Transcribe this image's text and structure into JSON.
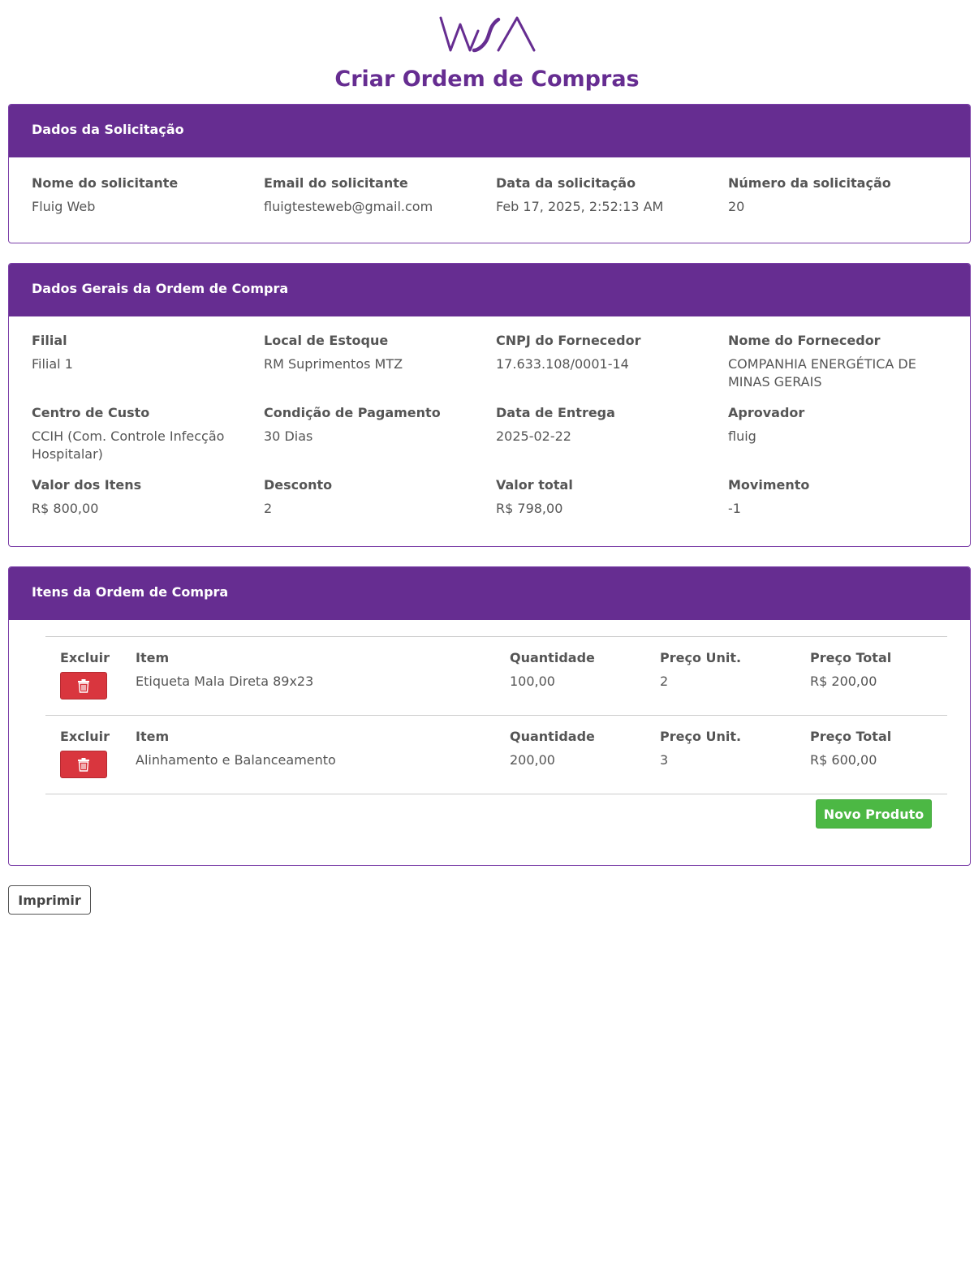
{
  "header": {
    "logo_text": "WSA",
    "page_title": "Criar Ordem de Compras"
  },
  "colors": {
    "brand_purple": "#662d91",
    "danger_red": "#d9363e",
    "success_green": "#4cb844"
  },
  "request": {
    "heading": "Dados da Solicitação",
    "fields": [
      {
        "label": "Nome do solicitante",
        "value": "Fluig Web"
      },
      {
        "label": "Email do solicitante",
        "value": "fluigtesteweb@gmail.com"
      },
      {
        "label": "Data da solicitação",
        "value": "Feb 17, 2025, 2:52:13 AM"
      },
      {
        "label": "Número da solicitação",
        "value": "20"
      }
    ]
  },
  "general": {
    "heading": "Dados Gerais da Ordem de Compra",
    "fields": [
      {
        "label": "Filial",
        "value": "Filial 1"
      },
      {
        "label": "Local de Estoque",
        "value": "RM Suprimentos MTZ"
      },
      {
        "label": "CNPJ do Fornecedor",
        "value": "17.633.108/0001-14"
      },
      {
        "label": "Nome do Fornecedor",
        "value": "COMPANHIA ENERGÉTICA DE MINAS GERAIS"
      },
      {
        "label": "Centro de Custo",
        "value": "CCIH (Com. Controle Infecção Hospitalar)"
      },
      {
        "label": "Condição de Pagamento",
        "value": "30 Dias"
      },
      {
        "label": "Data de Entrega",
        "value": "2025-02-22"
      },
      {
        "label": "Aprovador",
        "value": "fluig"
      },
      {
        "label": "Valor dos Itens",
        "value": "R$ 800,00"
      },
      {
        "label": "Desconto",
        "value": "2"
      },
      {
        "label": "Valor total",
        "value": "R$ 798,00"
      },
      {
        "label": "Movimento",
        "value": "-1"
      }
    ]
  },
  "items": {
    "heading": "Itens da Ordem de Compra",
    "columns": {
      "delete": "Excluir",
      "item": "Item",
      "quantity": "Quantidade",
      "unit_price": "Preço Unit.",
      "total_price": "Preço Total"
    },
    "delete_icon": "trash-icon",
    "rows": [
      {
        "item": "Etiqueta Mala Direta 89x23",
        "quantity": "100,00",
        "unit_price": "2",
        "total_price": "R$ 200,00"
      },
      {
        "item": "Alinhamento e Balanceamento",
        "quantity": "200,00",
        "unit_price": "3",
        "total_price": "R$ 600,00"
      }
    ],
    "add_button": "Novo Produto"
  },
  "print_button": "Imprimir"
}
